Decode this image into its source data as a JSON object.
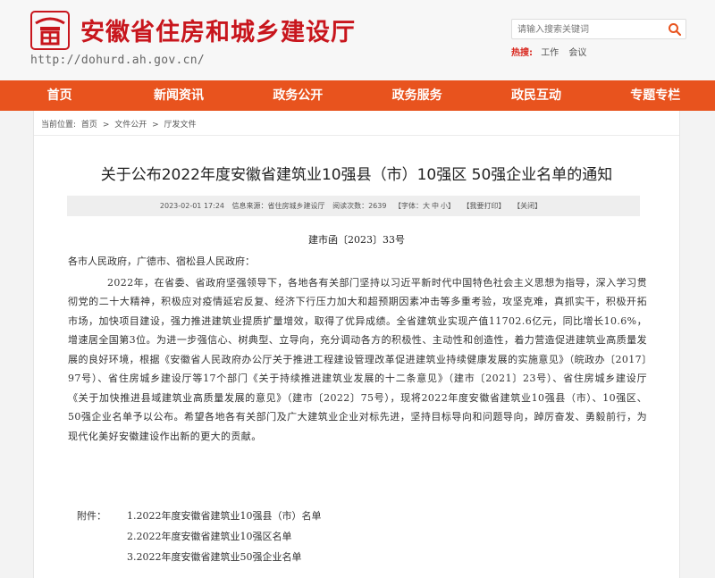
{
  "header": {
    "site_name": "安徽省住房和城乡建设厅",
    "url": "http://dohurd.ah.gov.cn/",
    "search": {
      "placeholder": "请输入搜索关键词",
      "icon": "search-icon"
    },
    "hot": {
      "label": "热搜:",
      "items": [
        "工作",
        "会议"
      ]
    },
    "colors": {
      "brand_red": "#c8161d",
      "nav_orange": "#e8531e"
    }
  },
  "nav": {
    "items": [
      "首页",
      "新闻资讯",
      "政务公开",
      "政务服务",
      "政民互动",
      "专题专栏"
    ]
  },
  "breadcrumb": {
    "label": "当前位置:",
    "items": [
      "首页",
      "文件公开",
      "厅发文件"
    ],
    "separator": ">"
  },
  "article": {
    "title": "关于公布2022年度安徽省建筑业10强县（市）10强区 50强企业名单的通知",
    "meta": {
      "date": "2023-02-01 17:24",
      "source_label": "信息来源：",
      "source": "省住房城乡建设厅",
      "views_label": "阅读次数：",
      "views": "2639",
      "font_label": "【字体：",
      "font_sizes": [
        "大",
        "中",
        "小"
      ],
      "font_close": "】",
      "print": "【我要打印】",
      "close": "【关闭】"
    },
    "doc_number": "建市函〔2023〕33号",
    "addressee": "各市人民政府，广德市、宿松县人民政府：",
    "paragraph": "2022年，在省委、省政府坚强领导下，各地各有关部门坚持以习近平新时代中国特色社会主义思想为指导，深入学习贯彻党的二十大精神，积极应对疫情延宕反复、经济下行压力加大和超预期因素冲击等多重考验，攻坚克难，真抓实干，积极开拓市场，加快项目建设，强力推进建筑业提质扩量增效，取得了优异成绩。全省建筑业实现产值11702.6亿元，同比增长10.6%，增速居全国第3位。为进一步强信心、树典型、立导向，充分调动各方的积极性、主动性和创造性，着力营造促进建筑业高质量发展的良好环境，根据《安徽省人民政府办公厅关于推进工程建设管理改革促进建筑业持续健康发展的实施意见》（皖政办〔2017〕97号）、省住房城乡建设厅等17个部门《关于持续推进建筑业发展的十二条意见》（建市〔2021〕23号）、省住房城乡建设厅《关于加快推进县域建筑业高质量发展的意见》（建市〔2022〕75号），现将2022年度安徽省建筑业10强县（市）、10强区、50强企业名单予以公布。希望各地各有关部门及广大建筑业企业对标先进，坚持目标导向和问题导向，踔厉奋发、勇毅前行，为现代化美好安徽建设作出新的更大的贡献。",
    "attachments": {
      "label": "附件：",
      "items": [
        "1.2022年度安徽省建筑业10强县（市）名单",
        "2.2022年度安徽省建筑业10强区名单",
        "3.2022年度安徽省建筑业50强企业名单"
      ]
    }
  }
}
